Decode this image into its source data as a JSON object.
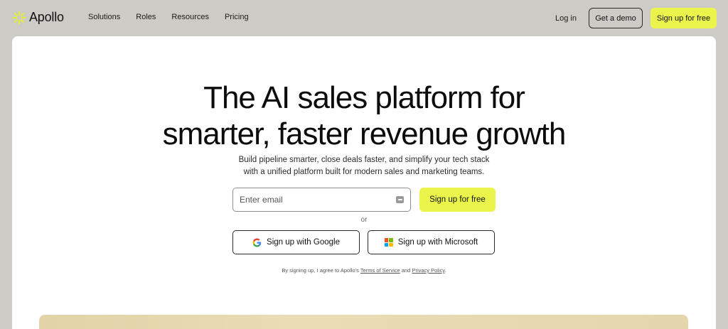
{
  "brand": {
    "name": "Apollo",
    "accent_color": "#ebf44a",
    "logo_icon": "apollo-sun-icon"
  },
  "nav": {
    "links": [
      "Solutions",
      "Roles",
      "Resources",
      "Pricing"
    ],
    "login_label": "Log in",
    "demo_label": "Get a demo",
    "signup_label": "Sign up for free"
  },
  "hero": {
    "headline_line1": "The AI sales platform for",
    "headline_line2": "smarter, faster revenue growth",
    "subhead_line1": "Build pipeline smarter, close deals faster, and simplify your tech stack",
    "subhead_line2": "with a unified platform built for modern sales and marketing teams.",
    "email_placeholder": "Enter email",
    "signup_label": "Sign up for free",
    "or_label": "or",
    "google_label": "Sign up with Google",
    "google_icon": "google-icon",
    "microsoft_label": "Sign up with Microsoft",
    "microsoft_icon": "microsoft-icon",
    "legal_prefix": "By signing up, I agree to Apollo's",
    "terms_label": "Terms of Service",
    "legal_and": "and",
    "privacy_label": "Privacy Policy",
    "legal_suffix": "."
  }
}
